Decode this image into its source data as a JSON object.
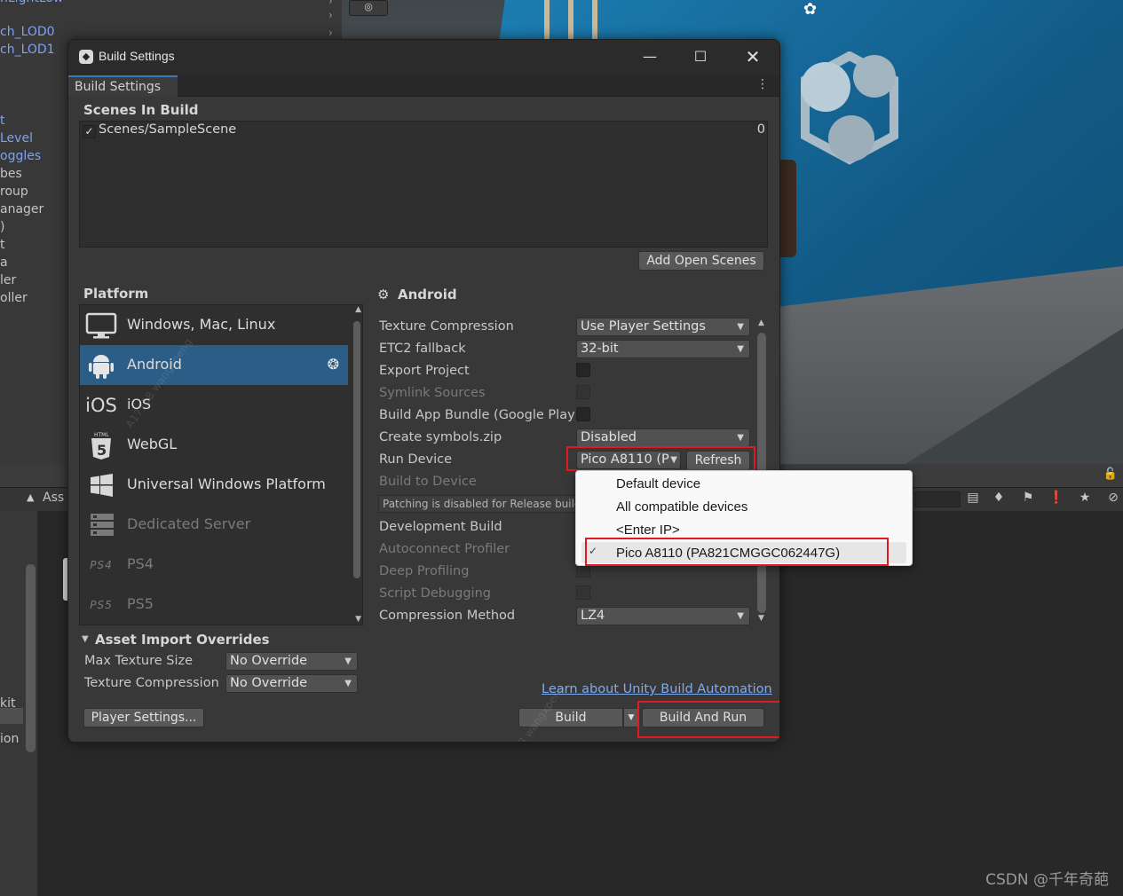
{
  "background": {
    "hierarchy_items": [
      "ch_LOD0",
      "ch_LOD1",
      "t",
      " Level",
      "oggles",
      "bes",
      "roup",
      "anager",
      ")",
      "t",
      "a",
      "ler",
      "oller"
    ],
    "bottom_panel_label": "Ass",
    "bottom_left_labels": [
      "kit",
      "ion"
    ],
    "watermark": "CSDN @千年奇葩"
  },
  "window": {
    "title": "Build Settings",
    "tab": "Build Settings",
    "scenes_header": "Scenes In Build",
    "scene_name": "Scenes/SampleScene",
    "scene_index": "0",
    "add_open_scenes": "Add Open Scenes",
    "platform_header": "Platform",
    "platforms": [
      {
        "label": "Windows, Mac, Linux",
        "icon": "monitor-icon"
      },
      {
        "label": "Android",
        "icon": "android-icon"
      },
      {
        "label": "iOS",
        "icon": "ios-icon",
        "icon_text": "iOS"
      },
      {
        "label": "WebGL",
        "icon": "html5-icon"
      },
      {
        "label": "Universal Windows Platform",
        "icon": "windows-icon"
      },
      {
        "label": "Dedicated Server",
        "icon": "server-icon"
      },
      {
        "label": "PS4",
        "icon": "ps4-icon",
        "icon_text": "PS4"
      },
      {
        "label": "PS5",
        "icon": "ps5-icon",
        "icon_text": "PS5"
      }
    ],
    "selected_platform": "Android",
    "settings_header": "Android",
    "settings": {
      "texture_compression_label": "Texture Compression",
      "texture_compression_value": "Use Player Settings",
      "etc2_label": "ETC2 fallback",
      "etc2_value": "32-bit",
      "export_project_label": "Export Project",
      "symlink_label": "Symlink Sources",
      "app_bundle_label": "Build App Bundle (Google Play)",
      "symbols_label": "Create symbols.zip",
      "symbols_value": "Disabled",
      "run_device_label": "Run Device",
      "run_device_value": "Pico A8110 (P",
      "refresh_label": "Refresh",
      "build_to_device_label": "Build to Device",
      "patching_note": "Patching is disabled for Release build",
      "dev_build_label": "Development Build",
      "autoconnect_label": "Autoconnect Profiler",
      "deep_profiling_label": "Deep Profiling",
      "script_debugging_label": "Script Debugging",
      "compression_label": "Compression Method",
      "compression_value": "LZ4"
    },
    "asset_overrides_header": "Asset Import Overrides",
    "max_texture_label": "Max Texture Size",
    "max_texture_value": "No Override",
    "override_compression_label": "Texture Compression",
    "override_compression_value": "No Override",
    "learn_link": "Learn about Unity Build Automation",
    "player_settings": "Player Settings...",
    "build": "Build",
    "build_and_run": "Build And Run"
  },
  "device_popup": {
    "items": [
      "Default device",
      "All compatible devices",
      "<Enter IP>",
      "Pico A8110 (PA821CMGGC062447G)"
    ],
    "selected": "Pico A8110 (PA821CMGGC062447G)"
  },
  "colors": {
    "highlight_box": "#e01a22",
    "selection_blue": "#2c5d87",
    "link": "#7eaaf0"
  }
}
